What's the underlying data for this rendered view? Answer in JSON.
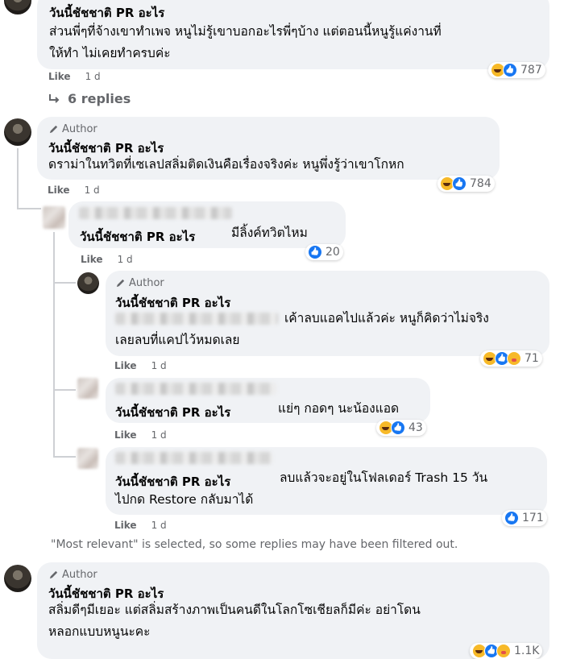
{
  "comments": [
    {
      "name": "วันนี้ชัชชาติ PR อะไร",
      "lines": [
        "ส่วนพี่ๆที่จ้างเขาทำเพจ หนูไม่รู้เขาบอกอะไรพี่ๆบ้าง แต่ตอนนี้หนูรู้แค่งานที่",
        "ให้ทำ ไม่เคยทำครบค่ะ"
      ],
      "like": "Like",
      "time": "1 d",
      "reaction_count": "787"
    },
    {
      "replies": "6 replies"
    },
    {
      "author": "Author",
      "name": "วันนี้ชัชชาติ PR อะไร",
      "lines": [
        "ดราม่าในทวิตที่เซเลปสลิ่มติดเงินคือเรื่องจริงค่ะ หนูพึ่งรู้ว่าเขาโกหก"
      ],
      "like": "Like",
      "time": "1 d",
      "reaction_count": "784"
    },
    {
      "name": "วันนี้ชัชชาติ PR อะไร",
      "text": "มีลิ้งค์ทวิตไหม",
      "like": "Like",
      "time": "1 d",
      "reaction_count": "20"
    },
    {
      "author": "Author",
      "name": "วันนี้ชัชชาติ PR อะไร",
      "line1": "เค้าลบแอคไปแล้วค่ะ หนูก็คิดว่าไม่จริง",
      "line2": "เลยลบที่แคปไว้หมดเลย",
      "like": "Like",
      "time": "1 d",
      "reaction_count": "71"
    },
    {
      "name": "วันนี้ชัชชาติ PR อะไร",
      "text": "แย่ๆ กอดๆ นะน้องแอด",
      "like": "Like",
      "time": "1 d",
      "reaction_count": "43"
    },
    {
      "name": "วันนี้ชัชชาติ PR อะไร",
      "text": "ลบแล้วจะอยู่ในโฟลเดอร์ Trash 15 วัน",
      "line2": "ไปกด Restore กลับมาได้",
      "like": "Like",
      "time": "1 d",
      "reaction_count": "171"
    },
    {
      "note": "\"Most relevant\" is selected, so some replies may have been filtered out."
    },
    {
      "author": "Author",
      "name": "วันนี้ชัชชาติ PR อะไร",
      "lines": [
        "สลิ่มดีๆมีเยอะ แต่สลิ่มสร้างภาพเป็นคนดีในโลกโซเชียลก็มีค่ะ อย่าโดน",
        "หลอกแบบหนูนะคะ"
      ],
      "reaction_count": "1.1K"
    }
  ],
  "colors": {
    "bubble": "#f0f2f5",
    "like_blue": "#1877f2",
    "meta_gray": "#65676b"
  }
}
